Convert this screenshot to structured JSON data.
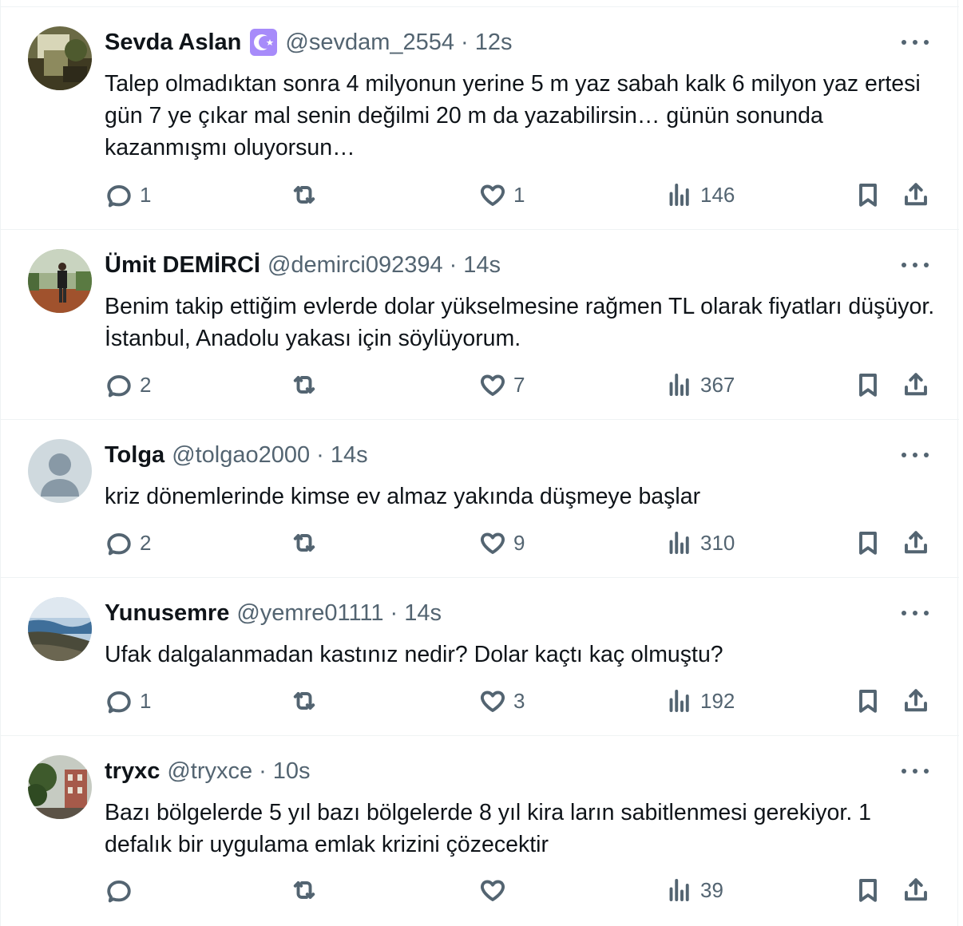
{
  "tweets": [
    {
      "name": "Sevda Aslan",
      "badge": "crescent-badge-icon",
      "handle": "@sevdam_2554",
      "time": "12s",
      "text": "Talep olmadıktan sonra 4 milyonun yerine 5 m yaz sabah kalk 6 milyon yaz ertesi gün 7 ye çıkar mal senin değilmi 20 m da yazabilirsin… günün sonunda kazanmışmı oluyorsun…",
      "replies": "1",
      "retweets": "",
      "likes": "1",
      "views": "146",
      "avatar": "photo-greenish"
    },
    {
      "name": "Ümit DEMİRCİ",
      "handle": "@demirci092394",
      "time": "14s",
      "text": "Benim takip ettiğim evlerde dolar yükselmesine rağmen TL olarak fiyatları düşüyor. İstanbul, Anadolu yakası için söylüyorum.",
      "replies": "2",
      "retweets": "",
      "likes": "7",
      "views": "367",
      "avatar": "photo-man-standing"
    },
    {
      "name": "Tolga",
      "handle": "@tolgao2000",
      "time": "14s",
      "text": "kriz dönemlerinde kimse ev almaz yakında düşmeye başlar",
      "replies": "2",
      "retweets": "",
      "likes": "9",
      "views": "310",
      "avatar": "default-avatar-icon"
    },
    {
      "name": "Yunusemre",
      "handle": "@yemre01111",
      "time": "14s",
      "text": "Ufak dalgalanmadan kastınız nedir? Dolar kaçtı kaç olmuştu?",
      "replies": "1",
      "retweets": "",
      "likes": "3",
      "views": "192",
      "avatar": "photo-landscape"
    },
    {
      "name": "tryxc",
      "handle": "@tryxce",
      "time": "10s",
      "text": "Bazı bölgelerde 5 yıl bazı bölgelerde 8 yıl kira ların sabitlenmesi gerekiyor. 1 defalık bir uygulama emlak krizini çözecektir",
      "replies": "",
      "retweets": "",
      "likes": "",
      "views": "39",
      "avatar": "photo-trees-house"
    }
  ],
  "colors": {
    "text": "#0f1419",
    "muted": "#536471",
    "divider": "#eff3f4",
    "badge": "#8b5cf6"
  }
}
